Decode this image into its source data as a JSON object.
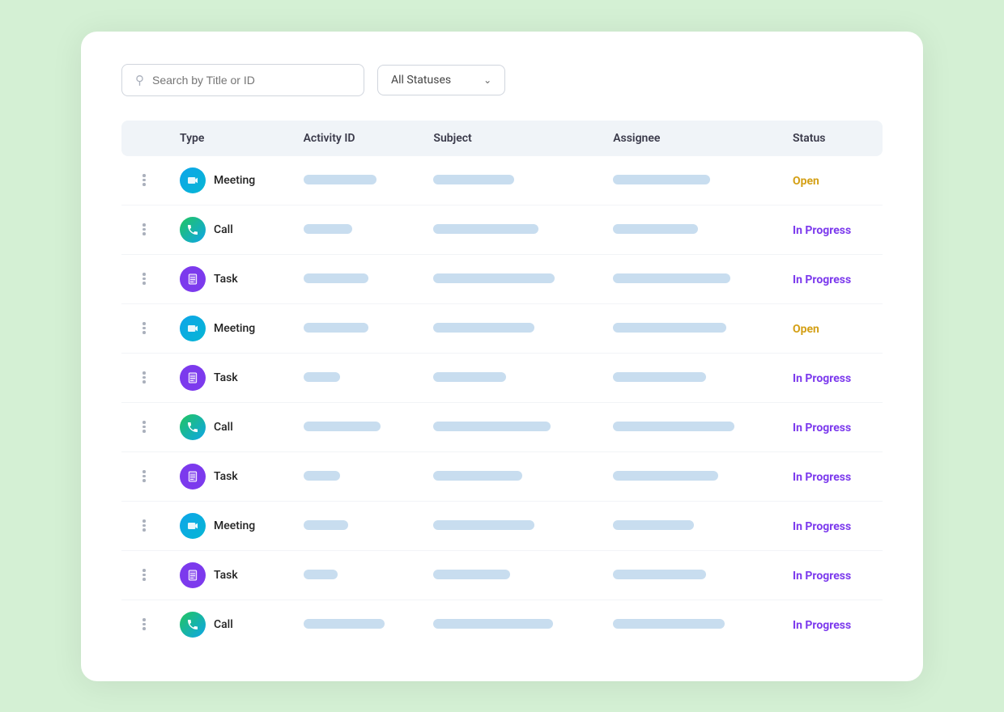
{
  "toolbar": {
    "search_placeholder": "Search by Title or ID",
    "status_dropdown_label": "All Statuses"
  },
  "table": {
    "headers": [
      "",
      "Type",
      "Activity ID",
      "Subject",
      "Assignee",
      "Status"
    ],
    "rows": [
      {
        "type": "Meeting",
        "type_key": "meeting",
        "activity_id_w": 90,
        "subject_w": 100,
        "assignee_w": 120,
        "status": "Open",
        "status_key": "open"
      },
      {
        "type": "Call",
        "type_key": "call",
        "activity_id_w": 60,
        "subject_w": 130,
        "assignee_w": 105,
        "status": "In Progress",
        "status_key": "inprogress"
      },
      {
        "type": "Task",
        "type_key": "task",
        "activity_id_w": 80,
        "subject_w": 150,
        "assignee_w": 145,
        "status": "In Progress",
        "status_key": "inprogress"
      },
      {
        "type": "Meeting",
        "type_key": "meeting",
        "activity_id_w": 80,
        "subject_w": 125,
        "assignee_w": 140,
        "status": "Open",
        "status_key": "open"
      },
      {
        "type": "Task",
        "type_key": "task",
        "activity_id_w": 45,
        "subject_w": 90,
        "assignee_w": 115,
        "status": "In Progress",
        "status_key": "inprogress"
      },
      {
        "type": "Call",
        "type_key": "call",
        "activity_id_w": 95,
        "subject_w": 145,
        "assignee_w": 150,
        "status": "In Progress",
        "status_key": "inprogress"
      },
      {
        "type": "Task",
        "type_key": "task",
        "activity_id_w": 45,
        "subject_w": 110,
        "assignee_w": 130,
        "status": "In Progress",
        "status_key": "inprogress"
      },
      {
        "type": "Meeting",
        "type_key": "meeting",
        "activity_id_w": 55,
        "subject_w": 125,
        "assignee_w": 100,
        "status": "In Progress",
        "status_key": "inprogress"
      },
      {
        "type": "Task",
        "type_key": "task",
        "activity_id_w": 42,
        "subject_w": 95,
        "assignee_w": 115,
        "status": "In Progress",
        "status_key": "inprogress"
      },
      {
        "type": "Call",
        "type_key": "call",
        "activity_id_w": 100,
        "subject_w": 148,
        "assignee_w": 138,
        "status": "In Progress",
        "status_key": "inprogress"
      }
    ]
  }
}
